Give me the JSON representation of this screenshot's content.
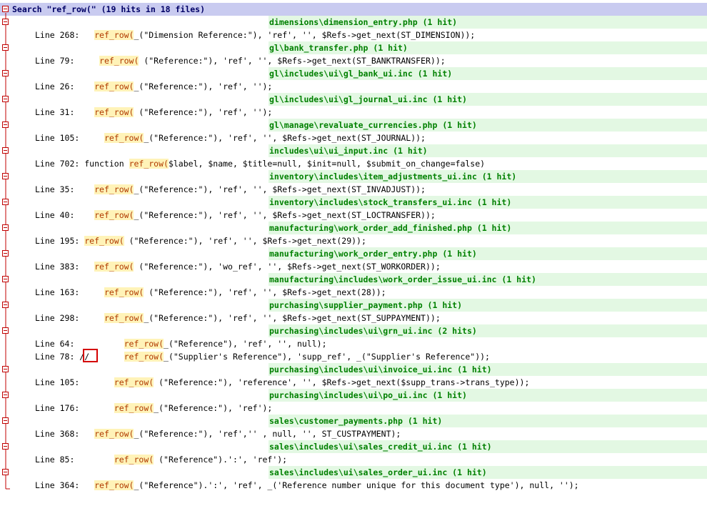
{
  "search": {
    "header": "Search \"ref_row(\" (19 hits in 18 files)"
  },
  "rows": [
    {
      "type": "file",
      "text": "dimensions\\dimension_entry.php (1 hit)"
    },
    {
      "type": "line",
      "prefix": "Line 268:   ",
      "hit": "ref_row(",
      "rest": "_(\"Dimension Reference:\"), 'ref', '', $Refs->get_next(ST_DIMENSION));"
    },
    {
      "type": "file",
      "text": "gl\\bank_transfer.php (1 hit)"
    },
    {
      "type": "line",
      "prefix": "Line 79:     ",
      "hit": "ref_row(",
      "rest": " (\"Reference:\"), 'ref', '', $Refs->get_next(ST_BANKTRANSFER));"
    },
    {
      "type": "file",
      "text": "gl\\includes\\ui\\gl_bank_ui.inc (1 hit)"
    },
    {
      "type": "line",
      "prefix": "Line 26:    ",
      "hit": "ref_row(",
      "rest": "_(\"Reference:\"), 'ref', '');"
    },
    {
      "type": "file",
      "text": "gl\\includes\\ui\\gl_journal_ui.inc (1 hit)"
    },
    {
      "type": "line",
      "prefix": "Line 31:    ",
      "hit": "ref_row(",
      "rest": " (\"Reference:\"), 'ref', '');"
    },
    {
      "type": "file",
      "text": "gl\\manage\\revaluate_currencies.php (1 hit)"
    },
    {
      "type": "line",
      "prefix": "Line 105:     ",
      "hit": "ref_row(",
      "rest": "_(\"Reference:\"), 'ref', '', $Refs->get_next(ST_JOURNAL));"
    },
    {
      "type": "file",
      "text": "includes\\ui\\ui_input.inc (1 hit)"
    },
    {
      "type": "line",
      "prefix": "Line 702: function ",
      "hit": "ref_row(",
      "rest": "$label, $name, $title=null, $init=null, $submit_on_change=false)"
    },
    {
      "type": "file",
      "text": "inventory\\includes\\item_adjustments_ui.inc (1 hit)"
    },
    {
      "type": "line",
      "prefix": "Line 35:    ",
      "hit": "ref_row(",
      "rest": "_(\"Reference:\"), 'ref', '', $Refs->get_next(ST_INVADJUST));"
    },
    {
      "type": "file",
      "text": "inventory\\includes\\stock_transfers_ui.inc (1 hit)"
    },
    {
      "type": "line",
      "prefix": "Line 40:    ",
      "hit": "ref_row(",
      "rest": "_(\"Reference:\"), 'ref', '', $Refs->get_next(ST_LOCTRANSFER));"
    },
    {
      "type": "file",
      "text": "manufacturing\\work_order_add_finished.php (1 hit)"
    },
    {
      "type": "line",
      "prefix": "Line 195: ",
      "hit": "ref_row(",
      "rest": " (\"Reference:\"), 'ref', '', $Refs->get_next(29));"
    },
    {
      "type": "file",
      "text": "manufacturing\\work_order_entry.php (1 hit)"
    },
    {
      "type": "line",
      "prefix": "Line 383:   ",
      "hit": "ref_row(",
      "rest": " (\"Reference:\"), 'wo_ref', '', $Refs->get_next(ST_WORKORDER));"
    },
    {
      "type": "file",
      "text": "manufacturing\\includes\\work_order_issue_ui.inc (1 hit)"
    },
    {
      "type": "line",
      "prefix": "Line 163:     ",
      "hit": "ref_row(",
      "rest": " (\"Reference:\"), 'ref', '', $Refs->get_next(28));"
    },
    {
      "type": "file",
      "text": "purchasing\\supplier_payment.php (1 hit)"
    },
    {
      "type": "line",
      "prefix": "Line 298:     ",
      "hit": "ref_row(",
      "rest": "_(\"Reference:\"), 'ref', '', $Refs->get_next(ST_SUPPAYMENT));"
    },
    {
      "type": "file",
      "text": "purchasing\\includes\\ui\\grn_ui.inc (2 hits)"
    },
    {
      "type": "line",
      "prefix": "Line 64:          ",
      "hit": "ref_row(",
      "rest": "_(\"Reference\"), 'ref', '', null);"
    },
    {
      "type": "line",
      "prefix": "Line 78: //       ",
      "hit": "ref_row(",
      "rest": "_(\"Supplier's Reference\"), 'supp_ref', _(\"Supplier's Reference\"));"
    },
    {
      "type": "file",
      "text": "purchasing\\includes\\ui\\invoice_ui.inc (1 hit)"
    },
    {
      "type": "line",
      "prefix": "Line 105:       ",
      "hit": "ref_row(",
      "rest": " (\"Reference:\"), 'reference', '', $Refs->get_next($supp_trans->trans_type));"
    },
    {
      "type": "file",
      "text": "purchasing\\includes\\ui\\po_ui.inc (1 hit)"
    },
    {
      "type": "line",
      "prefix": "Line 176:       ",
      "hit": "ref_row(",
      "rest": "_(\"Reference:\"), 'ref');"
    },
    {
      "type": "file",
      "text": "sales\\customer_payments.php (1 hit)"
    },
    {
      "type": "line",
      "prefix": "Line 368:   ",
      "hit": "ref_row(",
      "rest": "_(\"Reference:\"), 'ref','' , null, '', ST_CUSTPAYMENT);"
    },
    {
      "type": "file",
      "text": "sales\\includes\\ui\\sales_credit_ui.inc (1 hit)"
    },
    {
      "type": "line",
      "prefix": "Line 85:        ",
      "hit": "ref_row(",
      "rest": " (\"Reference\").':', 'ref');"
    },
    {
      "type": "file",
      "text": "sales\\includes\\ui\\sales_order_ui.inc (1 hit)"
    },
    {
      "type": "line",
      "prefix": "Line 364:   ",
      "hit": "ref_row(",
      "rest": "_(\"Reference\").':', 'ref', _('Reference number unique for this document type'), null, '');"
    }
  ],
  "colors": {
    "header_bg": "#c9cbf0",
    "file_band": "#e3f8e3",
    "file_text": "#008000",
    "hit_bg": "#fff3b8",
    "hit_text": "#b03a00",
    "annotation_box": "#d40000"
  }
}
